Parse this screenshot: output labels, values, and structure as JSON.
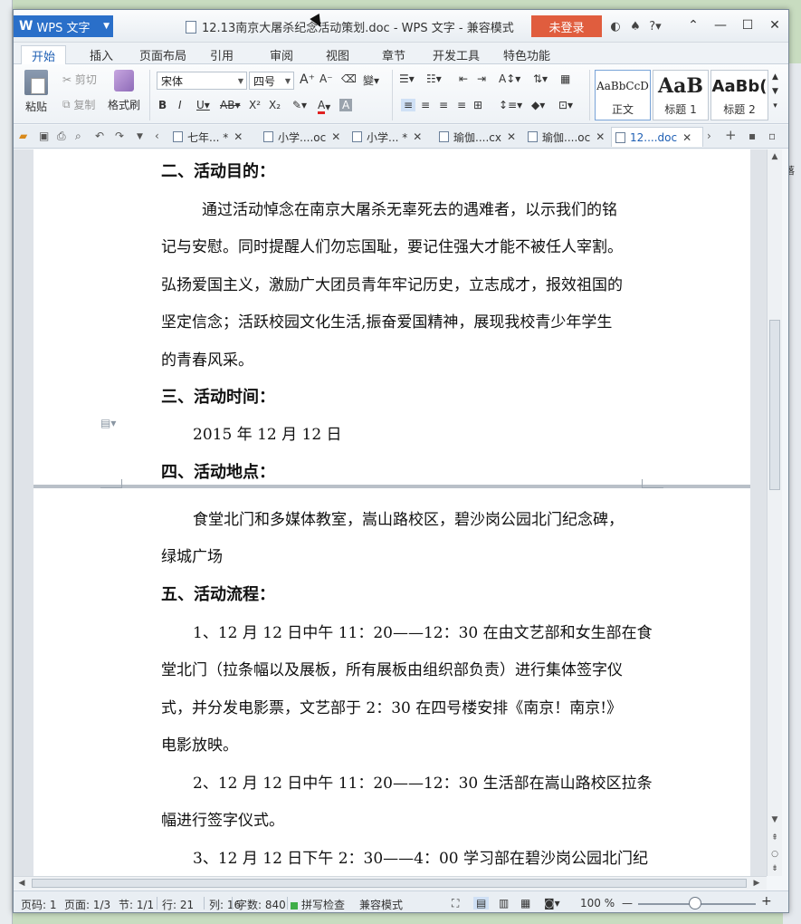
{
  "window": {
    "app_name": "WPS 文字",
    "title": "12.13南京大屠杀纪念活动策划.doc - WPS 文字 - 兼容模式",
    "login_label": "未登录"
  },
  "ribbon_tabs": [
    "开始",
    "插入",
    "页面布局",
    "引用",
    "审阅",
    "视图",
    "章节",
    "开发工具",
    "特色功能"
  ],
  "ribbon": {
    "paste": "粘贴",
    "cut": "剪切",
    "copy": "复制",
    "format_painter": "格式刷",
    "font_name": "宋体",
    "font_size": "四号",
    "styles": [
      {
        "sample": "AaBbCcD",
        "name": "正文"
      },
      {
        "sample": "AaB",
        "name": "标题 1"
      },
      {
        "sample": "AaBb(",
        "name": "标题 2"
      }
    ]
  },
  "doc_tabs": [
    {
      "label": "七年... *"
    },
    {
      "label": "小学....oc"
    },
    {
      "label": "小学... *"
    },
    {
      "label": "瑜伽....cx"
    },
    {
      "label": "瑜伽....oc"
    },
    {
      "label": "12....doc",
      "active": true
    }
  ],
  "document": {
    "heading2": "二、活动目的：",
    "purpose_lines": [
      "通过活动悼念在南京大屠杀无辜死去的遇难者，以示我们的铭",
      "记与安慰。同时提醒人们勿忘国耻，要记住强大才能不被任人宰割。",
      "弘扬爱国主义，激励广大团员青年牢记历史，立志成才，报效祖国的",
      "坚定信念；活跃校园文化生活,振奋爱国精神，展现我校青少年学生",
      "的青春风采。"
    ],
    "heading3": "三、活动时间：",
    "time_text": "2015 年 12 月 12 日",
    "heading4": "四、活动地点：",
    "location_lines": [
      "食堂北门和多媒体教室，嵩山路校区，碧沙岗公园北门纪念碑，",
      "绿城广场"
    ],
    "heading5": "五、活动流程：",
    "flow_lines": [
      "1、12 月 12 日中午 11：20——12：30 在由文艺部和女生部在食",
      "堂北门（拉条幅以及展板，所有展板由组织部负责）进行集体签字仪",
      "式，并分发电影票，文艺部于 2：30 在四号楼安排《南京！南京!》",
      "电影放映。",
      "2、12 月 12 日中午 11：20——12：30 生活部在嵩山路校区拉条",
      "幅进行签字仪式。",
      "3、12 月 12 日下午 2：30——4：00 学习部在碧沙岗公园北门纪"
    ]
  },
  "status": {
    "page_code": "页码: 1",
    "page": "页面: 1/3",
    "section": "节: 1/1",
    "row": "行: 21",
    "col": "列: 16",
    "word_count": "字数: 840",
    "spell_check": "拼写检查",
    "compat_mode": "兼容模式",
    "zoom": "100 %"
  }
}
